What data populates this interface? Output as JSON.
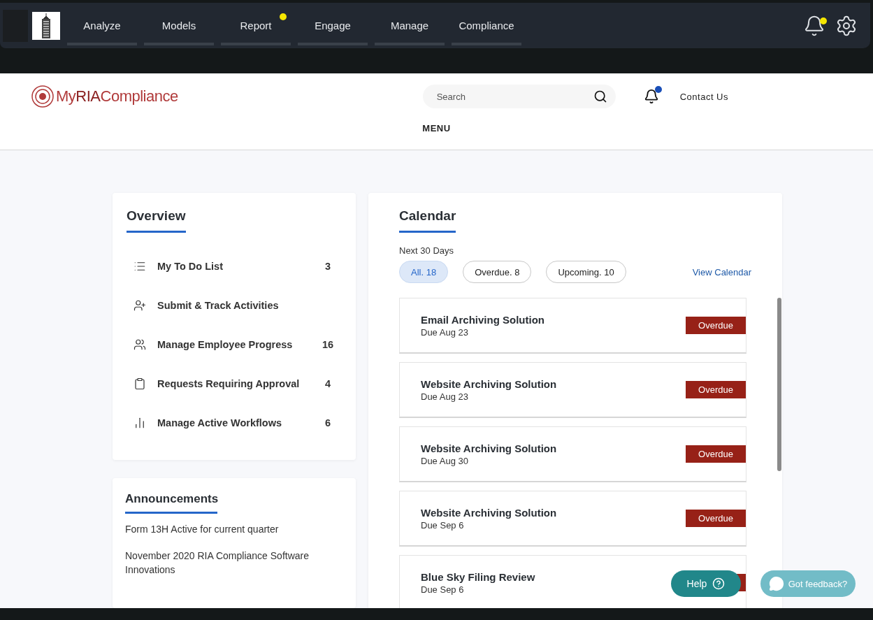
{
  "topbar": {
    "nav": [
      {
        "label": "Analyze",
        "notify": false
      },
      {
        "label": "Models",
        "notify": false
      },
      {
        "label": "Report",
        "notify": true
      },
      {
        "label": "Engage",
        "notify": false
      },
      {
        "label": "Manage",
        "notify": false
      },
      {
        "label": "Compliance",
        "notify": false
      }
    ],
    "bell_notify": true
  },
  "header": {
    "logo": {
      "prefix": "My",
      "accent": "RIA",
      "suffix": "Compliance"
    },
    "search": {
      "placeholder": "Search"
    },
    "bell_notify": true,
    "contact": "Contact Us",
    "menu": "MENU"
  },
  "overview": {
    "title": "Overview",
    "items": [
      {
        "kind": "list",
        "label": "My To Do List",
        "count": "3"
      },
      {
        "kind": "person-add",
        "label": "Submit & Track Activities"
      },
      {
        "kind": "people",
        "label": "Manage Employee Progress",
        "count": "16"
      },
      {
        "kind": "clipboard",
        "label": "Requests Requiring Approval",
        "count": "4"
      },
      {
        "kind": "chart",
        "label": "Manage Active Workflows",
        "count": "6"
      }
    ]
  },
  "announcements": {
    "title": "Announcements",
    "items": [
      "Form 13H Active for current quarter",
      "November 2020 RIA Compliance Software Innovations"
    ]
  },
  "calendar": {
    "title": "Calendar",
    "range": "Next 30 Days",
    "filters": [
      {
        "label": "All. 18",
        "selected": true
      },
      {
        "label": "Overdue. 8",
        "selected": false
      },
      {
        "label": "Upcoming. 10",
        "selected": false
      }
    ],
    "link": "View Calendar",
    "items": [
      {
        "title": "Email Archiving Solution",
        "due": "Due Aug 23",
        "overdue": true,
        "badge": "Overdue"
      },
      {
        "title": "Website Archiving Solution",
        "due": "Due Aug 23",
        "overdue": true,
        "badge": "Overdue"
      },
      {
        "title": "Website Archiving Solution",
        "due": "Due Aug 30",
        "overdue": true,
        "badge": "Overdue"
      },
      {
        "title": "Website Archiving Solution",
        "due": "Due Sep 6",
        "overdue": true,
        "badge": "Overdue"
      },
      {
        "title": "Blue Sky Filing Review",
        "due": "Due Sep 6",
        "overdue": true
      }
    ]
  },
  "help": "Help",
  "feedback": "Got feedback?"
}
